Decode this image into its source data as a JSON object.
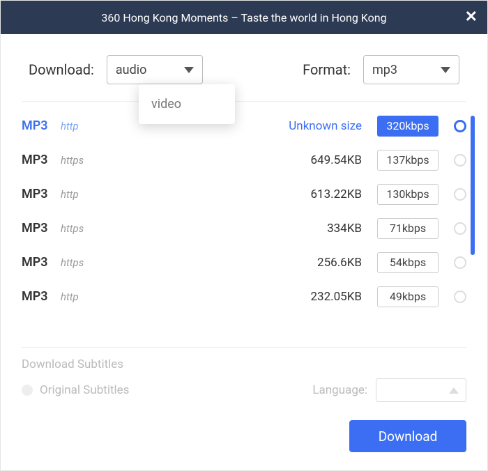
{
  "title": "360 Hong Kong Moments – Taste the world in Hong Kong",
  "controls": {
    "download_label": "Download:",
    "download_value": "audio",
    "format_label": "Format:",
    "format_value": "mp3",
    "dropdown_option": "video"
  },
  "rows": [
    {
      "format": "MP3",
      "protocol": "http",
      "size": "Unknown size",
      "bitrate": "320kbps",
      "selected": true
    },
    {
      "format": "MP3",
      "protocol": "https",
      "size": "649.54KB",
      "bitrate": "137kbps",
      "selected": false
    },
    {
      "format": "MP3",
      "protocol": "http",
      "size": "613.22KB",
      "bitrate": "130kbps",
      "selected": false
    },
    {
      "format": "MP3",
      "protocol": "https",
      "size": "334KB",
      "bitrate": "71kbps",
      "selected": false
    },
    {
      "format": "MP3",
      "protocol": "https",
      "size": "256.6KB",
      "bitrate": "54kbps",
      "selected": false
    },
    {
      "format": "MP3",
      "protocol": "http",
      "size": "232.05KB",
      "bitrate": "49kbps",
      "selected": false
    }
  ],
  "subtitles": {
    "header": "Download Subtitles",
    "original": "Original Subtitles",
    "language_label": "Language:"
  },
  "download_button": "Download"
}
